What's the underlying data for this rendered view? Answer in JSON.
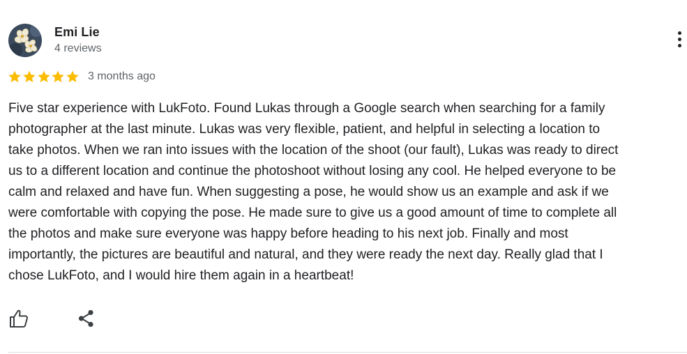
{
  "reviewer": {
    "name": "Emi Lie",
    "review_count": "4 reviews"
  },
  "rating": {
    "stars": 5,
    "max": 5,
    "color": "#fbbc04",
    "date": "3 months ago"
  },
  "review_text_lines": [
    "Five star experience with LukFoto. Found Lukas through a Google search when searching for a family",
    "photographer at the last minute. Lukas was very flexible, patient, and helpful in selecting a location to",
    "take photos. When we ran into issues with the location of the shoot (our fault), Lukas was ready to direct",
    "us to a different location and continue the photoshoot without losing any cool. He helped everyone to be",
    "calm and relaxed and have fun. When suggesting a pose, he would show us an example and ask if we",
    "were comfortable with copying the pose. He made sure to give us a good amount of time to complete all",
    "the photos and make sure everyone was happy before heading to his next job. Finally and most",
    "importantly, the pictures are beautiful and natural, and they were ready the next day. Really glad that I",
    "chose LukFoto, and I would hire them again in a heartbeat!"
  ],
  "icons": {
    "menu": "more-vert-icon",
    "like": "thumb-up-icon",
    "share": "share-icon"
  }
}
